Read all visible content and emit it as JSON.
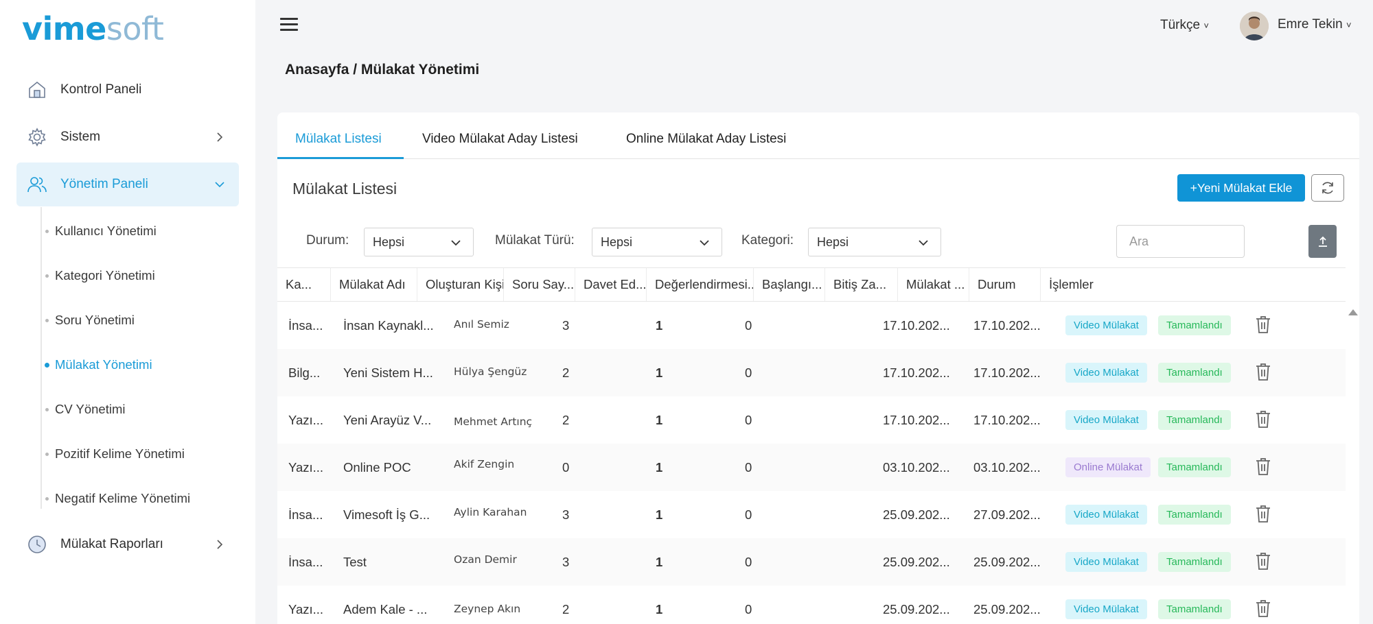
{
  "logo": {
    "part1": "vime",
    "part2": "soft"
  },
  "sidebar": {
    "items": [
      {
        "label": "Kontrol Paneli",
        "icon": "home-icon"
      },
      {
        "label": "Sistem",
        "icon": "gear-icon"
      },
      {
        "label": "Yönetim Paneli",
        "icon": "users-icon"
      },
      {
        "label": "Mülakat Raporları",
        "icon": "clock-icon"
      }
    ],
    "subitems": [
      "Kullanıcı Yönetimi",
      "Kategori Yönetimi",
      "Soru Yönetimi",
      "Mülakat Yönetimi",
      "CV Yönetimi",
      "Pozitif Kelime Yönetimi",
      "Negatif Kelime Yönetimi"
    ]
  },
  "header": {
    "language": "Türkçe",
    "user_name": "Emre Tekin"
  },
  "breadcrumb": "Anasayfa / Mülakat Yönetimi",
  "tabs": [
    "Mülakat Listesi",
    "Video Mülakat Aday Listesi",
    "Online Mülakat Aday Listesi"
  ],
  "card": {
    "title": "Mülakat Listesi",
    "new_button": "+Yeni Mülakat Ekle",
    "search_placeholder": "Ara"
  },
  "filters": {
    "durum": {
      "label": "Durum:",
      "value": "Hepsi"
    },
    "tur": {
      "label": "Mülakat Türü:",
      "value": "Hepsi"
    },
    "kategori": {
      "label": "Kategori:",
      "value": "Hepsi"
    }
  },
  "table": {
    "columns": [
      "Ka...",
      "Mülakat Adı",
      "Oluşturan Kişi",
      "Soru Say...",
      "Davet Ed...",
      "Değerlendirmesi...",
      "Başlangı...",
      "Bitiş Za...",
      "Mülakat ...",
      "Durum",
      "İşlemler"
    ],
    "rows": [
      {
        "kategori": "İnsa...",
        "ad": "İnsan Kaynakl...",
        "kisi": "Anıl Semiz",
        "soru": "3",
        "davet": "1",
        "deger": "0",
        "baslangic": "17.10.202...",
        "bitis": "17.10.202...",
        "tur": "Video Mülakat",
        "durum": "Tamamlandı"
      },
      {
        "kategori": "Bilg...",
        "ad": "Yeni Sistem H...",
        "kisi": "Hülya Şengüz",
        "soru": "2",
        "davet": "1",
        "deger": "0",
        "baslangic": "17.10.202...",
        "bitis": "17.10.202...",
        "tur": "Video Mülakat",
        "durum": "Tamamlandı"
      },
      {
        "kategori": "Yazı...",
        "ad": "Yeni Arayüz V...",
        "kisi": "Mehmet Artınç",
        "soru": "2",
        "davet": "1",
        "deger": "0",
        "baslangic": "17.10.202...",
        "bitis": "17.10.202...",
        "tur": "Video Mülakat",
        "durum": "Tamamlandı"
      },
      {
        "kategori": "Yazı...",
        "ad": "Online POC",
        "kisi": "Akif Zengin",
        "soru": "0",
        "davet": "1",
        "deger": "0",
        "baslangic": "03.10.202...",
        "bitis": "03.10.202...",
        "tur": "Online Mülakat",
        "durum": "Tamamlandı"
      },
      {
        "kategori": "İnsa...",
        "ad": "Vimesoft İş G...",
        "kisi": "Aylin Karahan",
        "soru": "3",
        "davet": "1",
        "deger": "0",
        "baslangic": "25.09.202...",
        "bitis": "27.09.202...",
        "tur": "Video Mülakat",
        "durum": "Tamamlandı"
      },
      {
        "kategori": "İnsa...",
        "ad": "Test",
        "kisi": "Ozan Demir",
        "soru": "3",
        "davet": "1",
        "deger": "0",
        "baslangic": "25.09.202...",
        "bitis": "25.09.202...",
        "tur": "Video Mülakat",
        "durum": "Tamamlandı"
      },
      {
        "kategori": "Yazı...",
        "ad": "Adem Kale - ...",
        "kisi": "Zeynep Akın",
        "soru": "2",
        "davet": "1",
        "deger": "0",
        "baslangic": "25.09.202...",
        "bitis": "25.09.202...",
        "tur": "Video Mülakat",
        "durum": "Tamamlandı"
      }
    ]
  },
  "colors": {
    "accent": "#1a9bd7",
    "primary_button": "#1094d6",
    "export_button": "#6f7880"
  }
}
